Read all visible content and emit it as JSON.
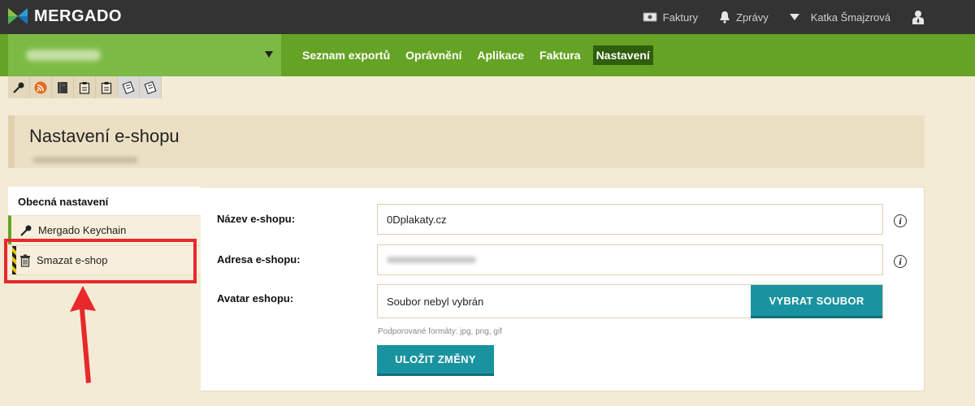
{
  "app": {
    "logo_text": "MERGADO",
    "icon": "mergado-logo-icon"
  },
  "topbar": {
    "invoices_label": "Faktury",
    "messages_label": "Zprávy",
    "user_name": "Katka Šmajzrová"
  },
  "nav": {
    "items": [
      {
        "label": "Seznam exportů",
        "active": false
      },
      {
        "label": "Oprávnění",
        "active": false
      },
      {
        "label": "Aplikace",
        "active": false
      },
      {
        "label": "Faktura",
        "active": false
      },
      {
        "label": "Nastavení",
        "active": true
      }
    ]
  },
  "toolbar": {
    "icons": [
      "key-icon",
      "rss-icon",
      "notebook-icon",
      "clipboard-icon",
      "clipboard-icon",
      "document-icon",
      "document-icon"
    ]
  },
  "page": {
    "title": "Nastavení e-shopu"
  },
  "sidebar": {
    "general_label": "Obecná nastavení",
    "items": [
      {
        "label": "Mergado Keychain",
        "icon": "key-icon"
      },
      {
        "label": "Smazat e-shop",
        "icon": "trash-icon"
      }
    ]
  },
  "form": {
    "name_label": "Název e-shopu:",
    "name_value": "0Dplakaty.cz",
    "address_label": "Adresa e-shopu:",
    "avatar_label": "Avatar eshopu:",
    "file_status": "Soubor nebyl vybrán",
    "choose_file_label": "VYBRAT SOUBOR",
    "formats_hint": "Podporované formáty: jpg, png, gif",
    "save_label": "ULOŽIT ZMĚNY",
    "info_glyph": "i"
  },
  "colors": {
    "topbar": "#333333",
    "nav_green": "#65a324",
    "nav_active": "#2f5e0c",
    "button_teal": "#1a93a0",
    "highlight_red": "#e8282b",
    "background": "#f4ebd6"
  }
}
